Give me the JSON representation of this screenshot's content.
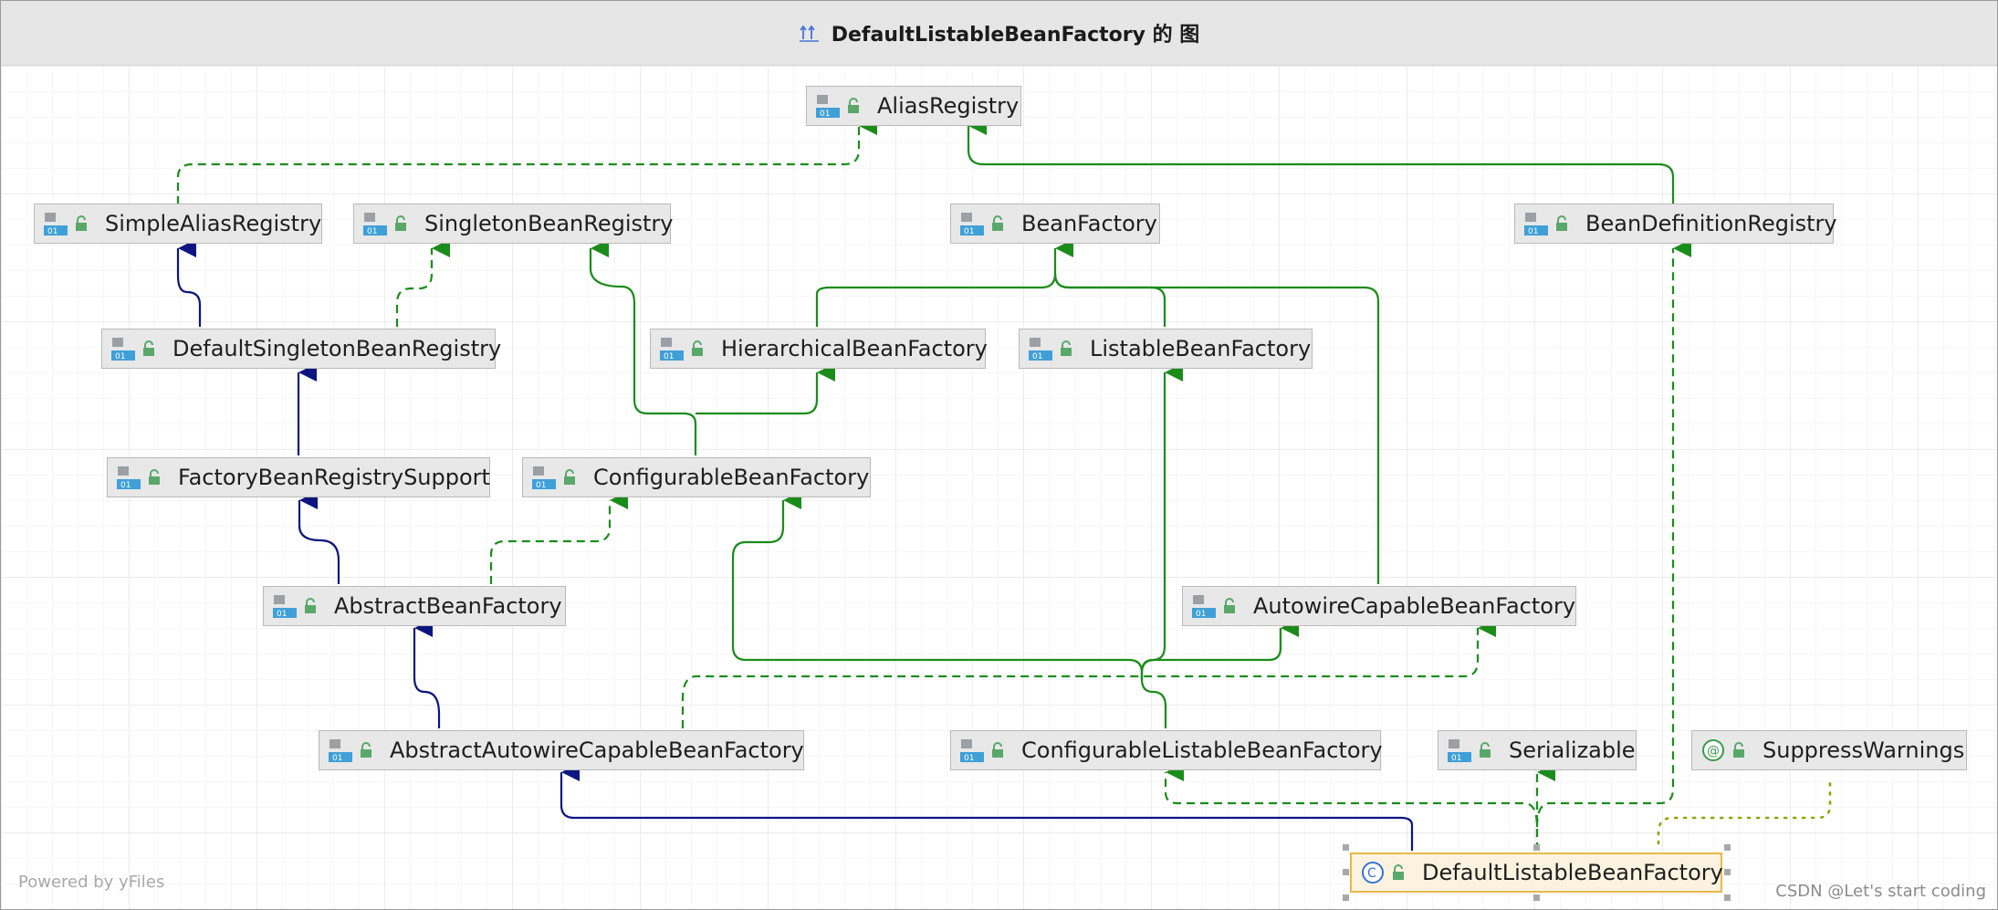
{
  "window": {
    "title": "DefaultListableBeanFactory 的 图"
  },
  "nodes": {
    "alias_registry": "AliasRegistry",
    "simple_alias_registry": "SimpleAliasRegistry",
    "singleton_bean_registry": "SingletonBeanRegistry",
    "bean_factory": "BeanFactory",
    "bean_definition_registry": "BeanDefinitionRegistry",
    "default_singleton_bean_registry": "DefaultSingletonBeanRegistry",
    "hierarchical_bean_factory": "HierarchicalBeanFactory",
    "listable_bean_factory": "ListableBeanFactory",
    "factory_bean_registry_support": "FactoryBeanRegistrySupport",
    "configurable_bean_factory": "ConfigurableBeanFactory",
    "abstract_bean_factory": "AbstractBeanFactory",
    "autowire_capable_bean_factory": "AutowireCapableBeanFactory",
    "abstract_autowire_capable_bean_factory": "AbstractAutowireCapableBeanFactory",
    "configurable_listable_bean_factory": "ConfigurableListableBeanFactory",
    "serializable": "Serializable",
    "suppress_warnings": "SuppressWarnings",
    "default_listable_bean_factory": "DefaultListableBeanFactory"
  },
  "footer": {
    "powered_by": "Powered by yFiles",
    "watermark": "CSDN @Let's start coding"
  },
  "colors": {
    "extends_edge": "#0d1580",
    "implements_edge": "#1a8c1a",
    "annotation_edge": "#8aa600",
    "selected_border": "#e6b94a"
  },
  "icons": {
    "interface": "interface-icon",
    "class": "class-icon",
    "annotation": "annotation-icon",
    "access": "unlocked-icon"
  }
}
